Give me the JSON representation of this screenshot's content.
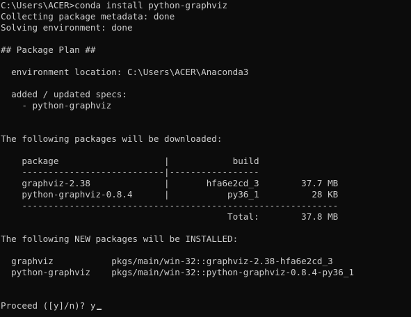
{
  "terminal": {
    "prompt": "C:\\Users\\ACER>",
    "command": "conda install python-graphviz",
    "lines": {
      "collecting": "Collecting package metadata: done",
      "solving": "Solving environment: done",
      "plan_header": "## Package Plan ##",
      "env_location": "  environment location: C:\\Users\\ACER\\Anaconda3",
      "specs_header": "  added / updated specs:",
      "spec_item": "    - python-graphviz",
      "download_header": "The following packages will be downloaded:",
      "table_header": "    package                    |            build",
      "table_sep": "    ---------------------------|-----------------",
      "row_1": "    graphviz-2.38              |       hfa6e2cd_3        37.7 MB",
      "row_2": "    python-graphviz-0.8.4      |           py36_1          28 KB",
      "table_sep_bottom": "    ------------------------------------------------------------",
      "total_row": "                                           Total:        37.8 MB",
      "new_header": "The following NEW packages will be INSTALLED:",
      "new_1": "  graphviz           pkgs/main/win-32::graphviz-2.38-hfa6e2cd_3",
      "new_2": "  python-graphviz    pkgs/main/win-32::python-graphviz-0.8.4-py36_1",
      "proceed_prompt": "Proceed ([y]/n)? ",
      "proceed_answer": "y"
    }
  }
}
